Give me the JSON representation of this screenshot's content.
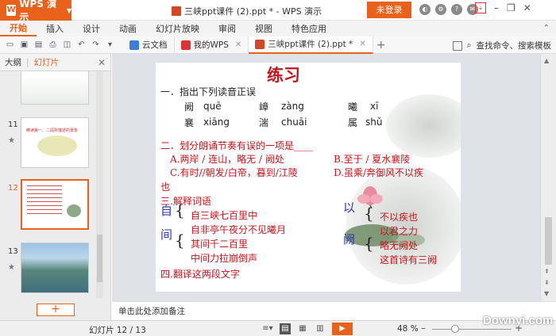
{
  "app": {
    "name": "WPS 演示",
    "window_title": "三峡ppt课件 (2).ppt * - WPS 演示",
    "login": "未登录"
  },
  "menu": [
    "开始",
    "插入",
    "设计",
    "动画",
    "幻灯片放映",
    "审阅",
    "视图",
    "特色应用"
  ],
  "tabs": [
    {
      "label": "云文档",
      "color": "#3b7dd8"
    },
    {
      "label": "我的WPS",
      "color": "#d33"
    },
    {
      "label": "三峡ppt课件 (2).ppt *",
      "color": "#d24726"
    }
  ],
  "search_cmd": "查找命令、搜索模板",
  "left_panel": {
    "tab_outline": "大纲",
    "tab_slides": "幻灯片",
    "slides": [
      "10",
      "11",
      "12",
      "13"
    ],
    "thumb11_title": "精读第一、二段所描述的景象"
  },
  "slide": {
    "title": "练习",
    "q1": "一．指出下列读音正误",
    "r1": [
      [
        "阙",
        "quē"
      ],
      [
        "嶂",
        "zàng"
      ],
      [
        "曦",
        "xī"
      ]
    ],
    "r2": [
      [
        "襄",
        "xiāng"
      ],
      [
        "湍",
        "chuāi"
      ],
      [
        "属",
        "shǔ"
      ]
    ],
    "q2": "二．划分朗诵节奏有误的一项是____",
    "a": "A.两岸 / 连山，略无 / 阙处",
    "b": "B.至于 / 夏水襄陵",
    "c": "C.有时//朝发/白帝，暮到/江陵",
    "d": "D.虽乘/奔御风不以疾",
    "d2": "也",
    "q3": "三.解释词语",
    "zi": "自",
    "zi1": "自三峡七百里中",
    "zi2": "自非亭午夜分不见曦月",
    "jian": "间",
    "jian1": "其间千二百里",
    "jian2": "中间力拉崩倒声",
    "yi": "以",
    "yi1": "不以疾也",
    "yi2": "以君之力",
    "que": "阙",
    "que1": "略无阙处",
    "que2": "这首诗有三阙",
    "q4": "四.翻译这两段文字"
  },
  "notes": "单击此处添加备注",
  "status": {
    "slide_count": "幻灯片 12 / 13",
    "zoom": "48 %"
  },
  "watermark": "Downyi.com"
}
